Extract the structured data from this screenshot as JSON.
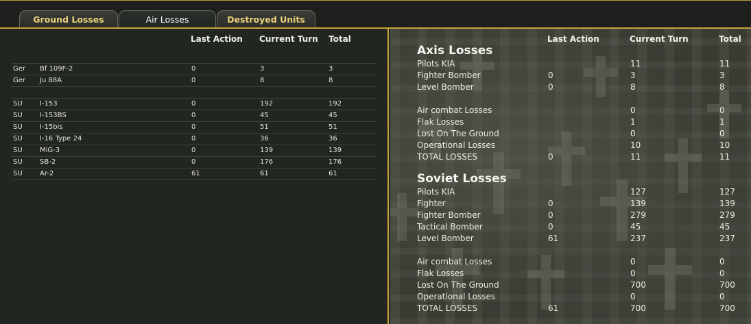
{
  "tabs": [
    {
      "label": "Ground Losses",
      "active": false
    },
    {
      "label": "Air Losses",
      "active": true
    },
    {
      "label": "Destroyed Units",
      "active": false
    }
  ],
  "left_table": {
    "headers": {
      "last_action": "Last Action",
      "current_turn": "Current Turn",
      "total": "Total"
    },
    "groups": [
      [
        {
          "nation": "Ger",
          "type": "Bf 109F-2",
          "last_action": "0",
          "current_turn": "3",
          "total": "3"
        },
        {
          "nation": "Ger",
          "type": "Ju 88A",
          "last_action": "0",
          "current_turn": "8",
          "total": "8"
        }
      ],
      [
        {
          "nation": "SU",
          "type": "I-153",
          "last_action": "0",
          "current_turn": "192",
          "total": "192"
        },
        {
          "nation": "SU",
          "type": "I-153BS",
          "last_action": "0",
          "current_turn": "45",
          "total": "45"
        },
        {
          "nation": "SU",
          "type": "I-15bis",
          "last_action": "0",
          "current_turn": "51",
          "total": "51"
        },
        {
          "nation": "SU",
          "type": "I-16 Type 24",
          "last_action": "0",
          "current_turn": "36",
          "total": "36"
        },
        {
          "nation": "SU",
          "type": "MiG-3",
          "last_action": "0",
          "current_turn": "139",
          "total": "139"
        },
        {
          "nation": "SU",
          "type": "SB-2",
          "last_action": "0",
          "current_turn": "176",
          "total": "176"
        },
        {
          "nation": "SU",
          "type": "Ar-2",
          "last_action": "61",
          "current_turn": "61",
          "total": "61"
        }
      ]
    ]
  },
  "summary": {
    "headers": {
      "last_action": "Last Action",
      "current_turn": "Current Turn",
      "total": "Total"
    },
    "axis": {
      "title": "Axis Losses",
      "rows": [
        {
          "label": "Pilots KIA",
          "last_action": "",
          "current_turn": "11",
          "total": "11"
        },
        {
          "label": "Fighter Bomber",
          "last_action": "0",
          "current_turn": "3",
          "total": "3"
        },
        {
          "label": "Level Bomber",
          "last_action": "0",
          "current_turn": "8",
          "total": "8"
        }
      ],
      "rows2": [
        {
          "label": "Air combat Losses",
          "last_action": "",
          "current_turn": "0",
          "total": "0"
        },
        {
          "label": "Flak Losses",
          "last_action": "",
          "current_turn": "1",
          "total": "1"
        },
        {
          "label": "Lost On The Ground",
          "last_action": "",
          "current_turn": "0",
          "total": "0"
        },
        {
          "label": "Operational Losses",
          "last_action": "",
          "current_turn": "10",
          "total": "10"
        },
        {
          "label": "TOTAL LOSSES",
          "last_action": "0",
          "current_turn": "11",
          "total": "11"
        }
      ]
    },
    "soviet": {
      "title": "Soviet Losses",
      "rows": [
        {
          "label": "Pilots KIA",
          "last_action": "",
          "current_turn": "127",
          "total": "127"
        },
        {
          "label": "Fighter",
          "last_action": "0",
          "current_turn": "139",
          "total": "139"
        },
        {
          "label": "Fighter Bomber",
          "last_action": "0",
          "current_turn": "279",
          "total": "279"
        },
        {
          "label": "Tactical Bomber",
          "last_action": "0",
          "current_turn": "45",
          "total": "45"
        },
        {
          "label": "Level Bomber",
          "last_action": "61",
          "current_turn": "237",
          "total": "237"
        }
      ],
      "rows2": [
        {
          "label": "Air combat Losses",
          "last_action": "",
          "current_turn": "0",
          "total": "0"
        },
        {
          "label": "Flak Losses",
          "last_action": "",
          "current_turn": "0",
          "total": "0"
        },
        {
          "label": "Lost On The Ground",
          "last_action": "",
          "current_turn": "700",
          "total": "700"
        },
        {
          "label": "Operational Losses",
          "last_action": "",
          "current_turn": "0",
          "total": "0"
        },
        {
          "label": "TOTAL LOSSES",
          "last_action": "61",
          "current_turn": "700",
          "total": "700"
        }
      ]
    }
  },
  "colors": {
    "accent_gold": "#c7a43c",
    "tab_text": "#e9d07a"
  }
}
